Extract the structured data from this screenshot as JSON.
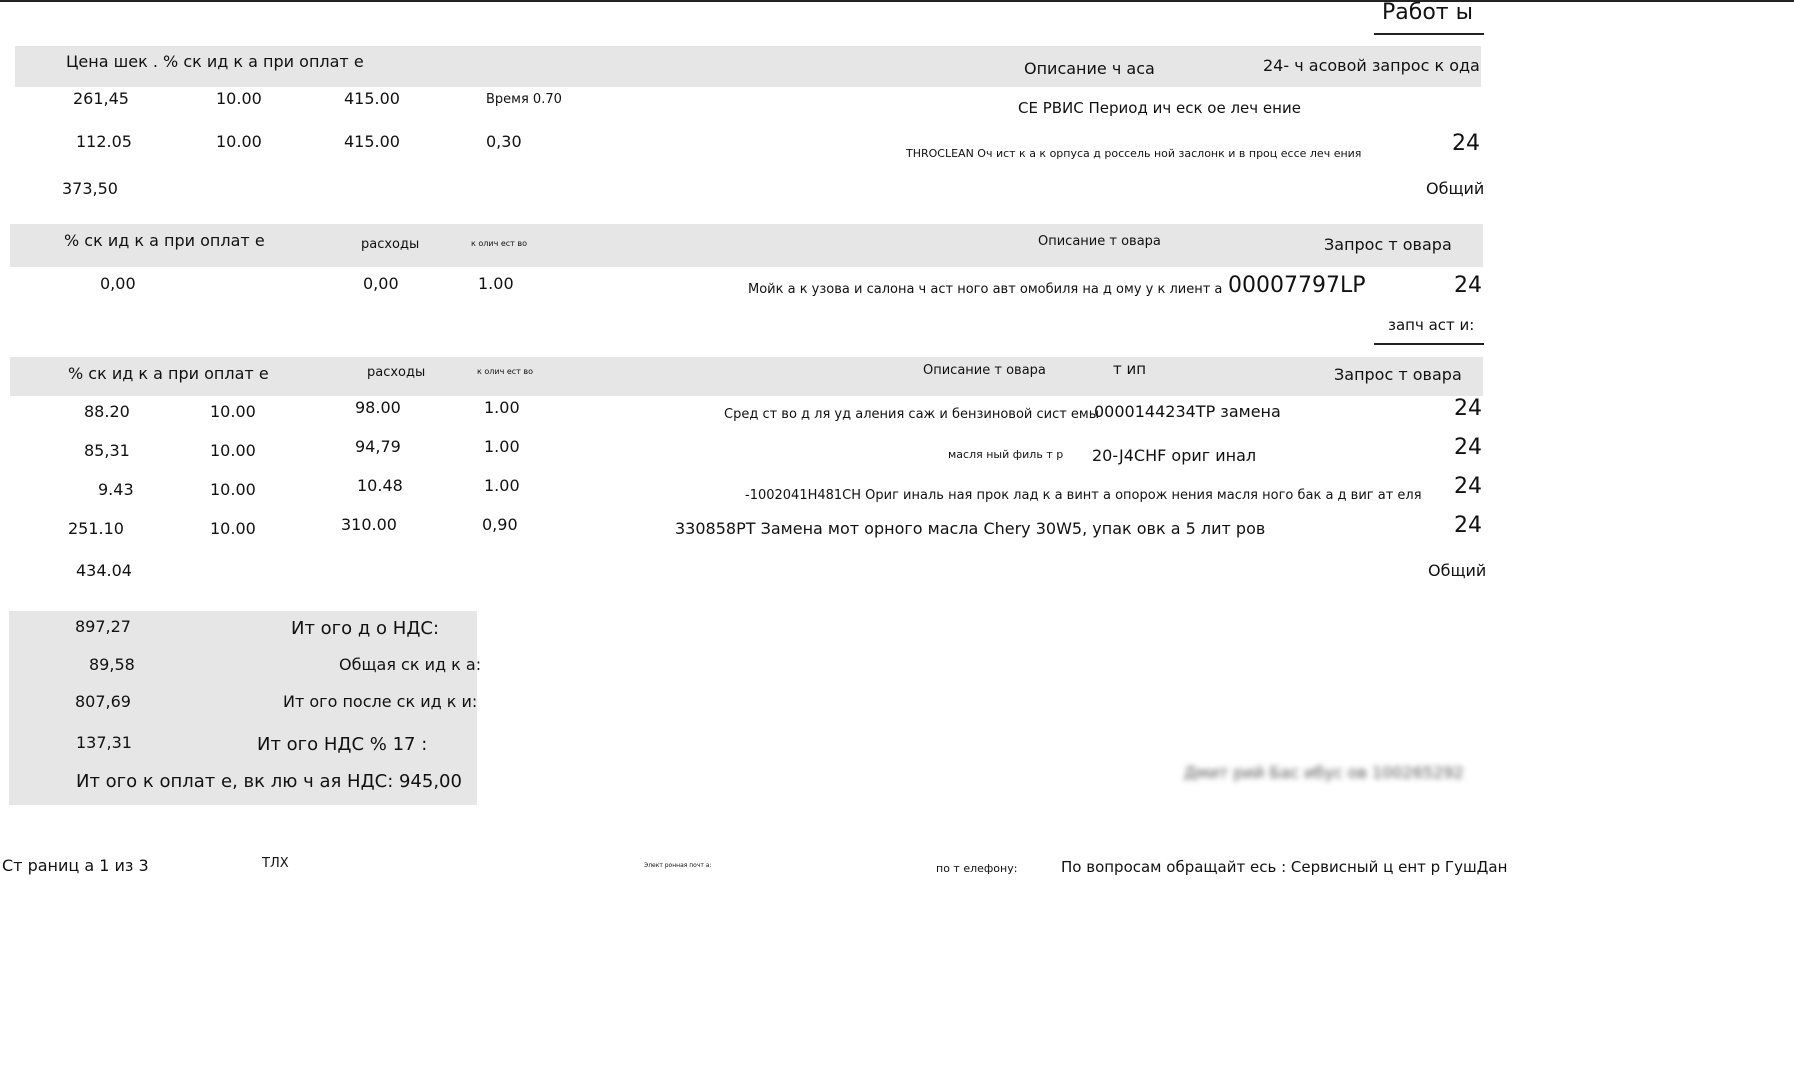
{
  "works": {
    "title": "Работ ы",
    "header": {
      "price_discount": "Цена шек . % ск ид к а при оплат е",
      "description": "Описание ч аса",
      "request": "24- ч асовой запрос к ода"
    },
    "rows": [
      {
        "price": "261,45",
        "discount": "10.00",
        "rate": "415.00",
        "time": "Время 0.70",
        "description": "СЕ РВИС Период ич еск ое леч ение",
        "code": ""
      },
      {
        "price": "112.05",
        "discount": "10.00",
        "rate": "415.00",
        "time": "0,30",
        "description": "THROCLEAN Оч ист к а к орпуса д россель ной заслонк и в проц ессе леч ения",
        "code": "24"
      }
    ],
    "total": "373,50",
    "total_label": "Общий"
  },
  "goods": {
    "header": {
      "discount": "% ск ид к а при оплат е",
      "expenses": "расходы",
      "quantity": "к олич ест во",
      "description": "Описание т овара",
      "request": "Запрос т овара"
    },
    "rows": [
      {
        "discount": "0,00",
        "expenses": "0,00",
        "quantity": "1.00",
        "description": "Мойк а к узова и салона ч аст ного авт омобиля на д ому у к лиент а",
        "article": "00007797LP",
        "code": "24"
      }
    ]
  },
  "parts": {
    "title": "запч аст и:",
    "header": {
      "discount": "% ск ид к а при оплат е",
      "expenses": "расходы",
      "quantity": "к олич ест во",
      "description": "Описание т овара",
      "type": "т ип",
      "request": "Запрос т овара"
    },
    "rows": [
      {
        "sum": "88.20",
        "discount": "10.00",
        "price": "98.00",
        "quantity": "1.00",
        "description": "Сред ст во д ля уд аления саж и бензиновой сист емы",
        "type": "0000144234TP замена",
        "code": "24"
      },
      {
        "sum": "85,31",
        "discount": "10.00",
        "price": "94,79",
        "quantity": "1.00",
        "description": "масля ный филь т р",
        "type": "20-J4CHF ориг инал",
        "code": "24"
      },
      {
        "sum": "9.43",
        "discount": "10.00",
        "price": "10.48",
        "quantity": "1.00",
        "description": "-1002041H481CH Ориг иналь ная прок лад к а винт а опорож нения масля ного бак а д виг ат еля",
        "type": "",
        "code": "24"
      },
      {
        "sum": "251.10",
        "discount": "10.00",
        "price": "310.00",
        "quantity": "0,90",
        "description": "330858PT Замена мот орного масла Chery 30W5, упак овк а 5 лит ров",
        "type": "",
        "code": "24"
      }
    ],
    "total": "434.04",
    "total_label": "Общий"
  },
  "summary": {
    "items": [
      {
        "value": "897,27",
        "label": "Ит ого д о НДС:"
      },
      {
        "value": "89,58",
        "label": "Общая ск ид к а:"
      },
      {
        "value": "807,69",
        "label": "Ит ого после ск ид к и:"
      },
      {
        "value": "137,31",
        "label": "Ит ого НДС % 17 :"
      }
    ],
    "grand_total": "Ит ого к оплат е, вк лю ч ая НДС: 945,00"
  },
  "signature": "Дмит рий Бас ибус ов 100265292",
  "footer": {
    "page": "Ст раниц а 1 из 3",
    "tlx": "ТЛХ",
    "email": "Элект ронная почт а:",
    "phone": "по т елефону:",
    "contact": "По вопросам обращайт есь : Сервисный ц ент р ГушДан"
  }
}
